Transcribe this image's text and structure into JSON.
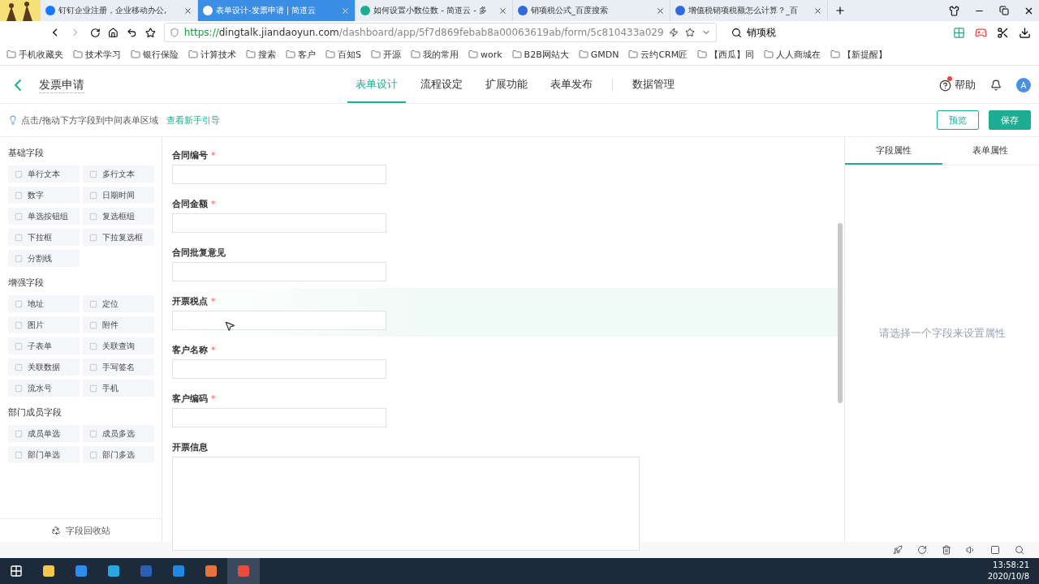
{
  "browser": {
    "tabs": [
      {
        "title": "钉钉企业注册，企业移动办公,",
        "selected": false
      },
      {
        "title": "表单设计-发票申请 | 简道云",
        "selected": true
      },
      {
        "title": "如何设置小数位数 - 简道云 - 多",
        "selected": false
      },
      {
        "title": "销项税公式_百度搜索",
        "selected": false
      },
      {
        "title": "增值税销项税额怎么计算？_百",
        "selected": false
      }
    ],
    "address": {
      "scheme": "https://",
      "host": "dingtalk.jiandaoyun.com",
      "path": "/dashboard/app/5f7d869febab8a00063619ab/form/5c810433a029"
    },
    "search": {
      "value": "销项税"
    },
    "bookmarks": [
      "手机收藏夹",
      "技术学习",
      "银行保险",
      "计算技术",
      "搜索",
      "客户",
      "百知S",
      "开源",
      "我的常用",
      "work",
      "B2B网站大",
      "GMDN",
      "云约CRM匠",
      "【西瓜】同",
      "人人商城在",
      "【新提醒】"
    ]
  },
  "app": {
    "title": "发票申请",
    "nav": [
      {
        "label": "表单设计",
        "selected": true
      },
      {
        "label": "流程设定",
        "selected": false
      },
      {
        "label": "扩展功能",
        "selected": false
      },
      {
        "label": "表单发布",
        "selected": false
      },
      {
        "label": "数据管理",
        "selected": false
      }
    ],
    "help": "帮助",
    "help_badge": true,
    "avatar": "A",
    "hint": "点击/拖动下方字段到中间表单区域",
    "guide_link": "查看新手引导",
    "buttons": {
      "preview": "预览",
      "save": "保存"
    }
  },
  "palette": {
    "groups": [
      {
        "title": "基础字段",
        "items": [
          "单行文本",
          "多行文本",
          "数字",
          "日期时间",
          "单选按钮组",
          "复选框组",
          "下拉框",
          "下拉复选框",
          "分割线"
        ]
      },
      {
        "title": "增强字段",
        "items": [
          "地址",
          "定位",
          "图片",
          "附件",
          "子表单",
          "关联查询",
          "关联数据",
          "手写签名",
          "流水号",
          "手机"
        ]
      },
      {
        "title": "部门成员字段",
        "items": [
          "成员单选",
          "成员多选",
          "部门单选",
          "部门多选"
        ]
      }
    ],
    "recycle": "字段回收站"
  },
  "form": {
    "fields": [
      {
        "label": "合同编号",
        "required_mark": "*",
        "kind": "input",
        "hovered": false
      },
      {
        "label": "合同金额",
        "required_mark": "*",
        "kind": "input",
        "hovered": false
      },
      {
        "label": "合同批复意见",
        "kind": "input",
        "hovered": false
      },
      {
        "label": "开票税点",
        "required_mark": "*",
        "kind": "input",
        "hovered": true
      },
      {
        "label": "客户名称",
        "required_mark": "*",
        "kind": "input",
        "hovered": false
      },
      {
        "label": "客户编码",
        "required_mark": "*",
        "kind": "input",
        "hovered": false
      },
      {
        "label": "开票信息",
        "kind": "textarea",
        "hovered": false
      }
    ]
  },
  "properties": {
    "tabs": [
      {
        "label": "字段属性",
        "selected": true
      },
      {
        "label": "表单属性",
        "selected": false
      }
    ],
    "empty": "请选择一个字段来设置属性"
  },
  "taskbar": {
    "time": "13:58:21",
    "date": "2020/10/8"
  }
}
